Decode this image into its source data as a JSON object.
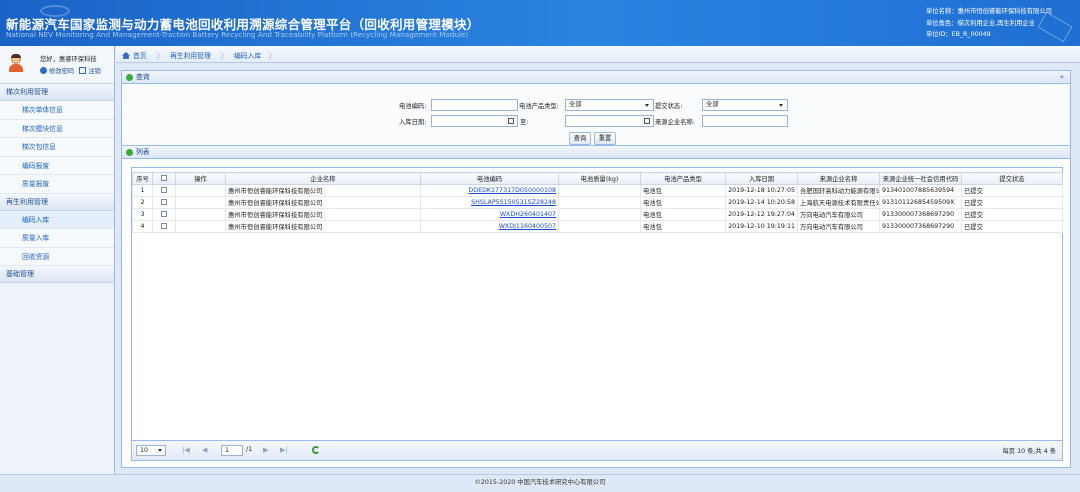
{
  "header": {
    "title": "新能源汽车国家监测与动力蓄电池回收利用溯源综合管理平台（回收利用管理模块）",
    "subtitle": "National NEV Monitoring And Management-Traction Battery Recycling And Traceability Platform (Recycling Management Module)",
    "unit_name": "单位名称：惠州市恒创睿能环保科技有限公司",
    "unit_role": "单位角色：梯次利用企业,再生利用企业",
    "unit_id": "单位ID：EB_R_00049"
  },
  "user": {
    "greeting": "您好，惠睿环保科技",
    "change_password": "修改密码",
    "logout": "注销"
  },
  "sidebar": {
    "groups": [
      {
        "label": "梯次利用管理",
        "items": [
          "梯次单体信息",
          "梯次模块信息",
          "梯次包信息",
          "编码报废",
          "质量报废"
        ]
      },
      {
        "label": "再生利用管理",
        "items": [
          "编码入库",
          "质量入库",
          "回收资源"
        ]
      },
      {
        "label": "基础管理",
        "items": []
      }
    ]
  },
  "breadcrumb": {
    "home": "首页",
    "level1": "再生利用管理",
    "level2": "编码入库"
  },
  "query": {
    "title": "查询",
    "collapse": "»",
    "battery_code_label": "电池编码:",
    "product_type_label": "电池产品类型:",
    "product_type_value": "全部",
    "submit_status_label": "提交状态:",
    "submit_status_value": "全部",
    "date_label": "入库日期:",
    "date_to_label": "至:",
    "source_company_label": "来源企业名称:",
    "search_button": "查询",
    "reset_button": "重置"
  },
  "list": {
    "title": "列表",
    "columns": [
      "序号",
      "",
      "操作",
      "企业名称",
      "电池编码",
      "电池质量(kg)",
      "电池产品类型",
      "入库日期",
      "来源企业名称",
      "来源企业统一社会信用代码",
      "提交状态"
    ],
    "rows": [
      {
        "no": "1",
        "company": "惠州市恒创睿能环保科技有限公司",
        "code": "DDEDK177317D050000108",
        "weight": "",
        "type": "电池包",
        "date": "2019-12-18 10:27:05",
        "source": "合肥国轩高科动力能源有限公司",
        "credit": "913401007885639594",
        "status": "已提交"
      },
      {
        "no": "2",
        "company": "惠州市恒创睿能环保科技有限公司",
        "code": "SHSLAP5S150531SZ28248",
        "weight": "",
        "type": "电池包",
        "date": "2019-12-14 10:20:58",
        "source": "上海航天电源技术有限责任公司",
        "credit": "91310112685459509X",
        "status": "已提交"
      },
      {
        "no": "3",
        "company": "惠州市恒创睿能环保科技有限公司",
        "code": "WXDH260401407",
        "weight": "",
        "type": "电池包",
        "date": "2019-12-12 19:27:04",
        "source": "万向电动汽车有限公司",
        "credit": "913300007368697290",
        "status": "已提交"
      },
      {
        "no": "4",
        "company": "惠州市恒创睿能环保科技有限公司",
        "code": "WXDJ1160400507",
        "weight": "",
        "type": "电池包",
        "date": "2019-12-10 19:19:11",
        "source": "万向电动汽车有限公司",
        "credit": "913300007368697290",
        "status": "已提交"
      }
    ]
  },
  "pager": {
    "page_size": "10",
    "page": "1",
    "total_pages": "/1",
    "summary": "每页 10 条,共 4 条"
  },
  "footer": {
    "text": "©2015-2020 中国汽车技术研究中心有限公司"
  }
}
